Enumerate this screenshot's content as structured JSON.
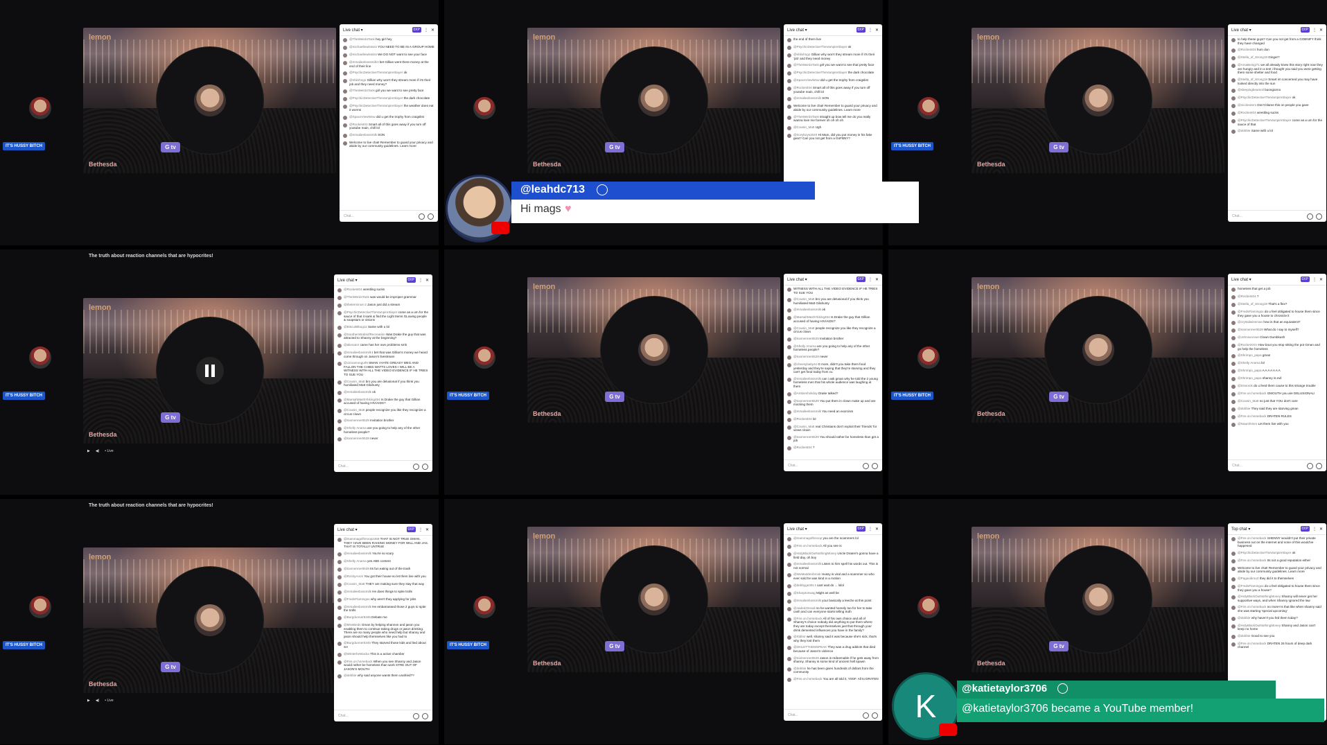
{
  "common": {
    "chat_header": "Live chat",
    "xp_badge": "0XP",
    "brand": "lemon",
    "bethesda": "Bethesda",
    "gtv": "G tv",
    "hussy_label": "IT'S HUSSY BITCH",
    "chat_placeholder": "Chat...",
    "video_title": "The truth about reaction channels that are hypocrites!",
    "live_label": "• Live"
  },
  "tiles": [
    {
      "id": "t1",
      "messages": [
        {
          "author": "@TheWeirdoTank",
          "text": "hey girl hey"
        },
        {
          "author": "@michaellewisssss",
          "text": "YOU NEED TO BE IN A GROUP HOME"
        },
        {
          "author": "@michaellewisssss",
          "text": "We DO NOT want to see your face"
        },
        {
          "author": "@mrsalieebossmilk",
          "text": "I bet Gillian went there money at the end of their line"
        },
        {
          "author": "@PsychicDetectiveTheVampireSlayer",
          "text": "ok"
        },
        {
          "author": "@shilohngo",
          "text": "Gillian why won't they stream more if it's their job and they need money?"
        },
        {
          "author": "@TheWeirdoTank",
          "text": "girl you we want to see pretty face"
        },
        {
          "author": "@PsychicDetectiveTheVampireSlayer",
          "text": "the dark chocolate"
        },
        {
          "author": "@PsychicDetectiveTheVampireSlayer",
          "text": "the weather does eat it worms"
        },
        {
          "author": "@SpaceViewWow",
          "text": "did u get the trophy from craigslist"
        },
        {
          "author": "@Rocket404",
          "text": "Smart all of this goes away if you turn off youtube main, chill lol"
        },
        {
          "author": "@mrsalieebossmilk",
          "text": "SON"
        },
        {
          "author": "",
          "text": "Welcome to live chat! Remember to guard your privacy and abide by our community guidelines. Learn more"
        }
      ]
    },
    {
      "id": "t2",
      "messages": [
        {
          "author": "",
          "text": "the end of them live"
        },
        {
          "author": "@PsychicDetectiveTheVampireSlayer",
          "text": "ok"
        },
        {
          "author": "@shilohngo",
          "text": "Gillian why won't they stream more if it's their 'job' and they need money"
        },
        {
          "author": "@TheWeirdoTank",
          "text": "girl you we want to see that pretty face"
        },
        {
          "author": "@PsychicDetectiveTheVampireSlayer",
          "text": "the dark chocolate"
        },
        {
          "author": "@SpaceViewWow",
          "text": "did u get the trophy from craigslist"
        },
        {
          "author": "@Rocket404",
          "text": "Smart all of this goes away if you turn off youtube main, chill lol"
        },
        {
          "author": "@mrsalieebossmilk",
          "text": "SON"
        },
        {
          "author": "",
          "text": "Welcome to live chat! Remember to guard your privacy and abide by our community guidelines. Learn more"
        },
        {
          "author": "@TheWeirdoTank",
          "text": "straight up bow tell me do you really wanna love me forever oh oh oh oh"
        },
        {
          "author": "@Cousin_Matt",
          "text": "Ugh"
        },
        {
          "author": "@riceyboys2040",
          "text": "Hi Mam, did you put money in his fake gear? Can you not get from a GoFBNY?"
        }
      ]
    },
    {
      "id": "t3",
      "messages": [
        {
          "author": "",
          "text": "to help these guys? Can you not get from a GOBNIFY think they have changed"
        },
        {
          "author": "@Rocket404",
          "text": "hum dun"
        },
        {
          "author": "@Stella_of_strong19",
          "text": "Ginger?"
        },
        {
          "author": "@AmaBeingi71",
          "text": "we all already knew this story right now they are hungry and in a tent i thought you said you were getting them some shelter and food"
        },
        {
          "author": "@Stella_of_strong19",
          "text": "Smart im concerned you may have looked directly into the sun"
        },
        {
          "author": "@sleepingbearsoil",
          "text": "buongiorno"
        },
        {
          "author": "@PsychicDetectiveTheVampireSlayer",
          "text": "ok"
        },
        {
          "author": "@nicoleotero",
          "text": "Don't blame this on people you gave"
        },
        {
          "author": "@Rocket404",
          "text": "wrestling sucks"
        },
        {
          "author": "@PsychicDetectiveTheVampireSlayer",
          "text": "come as a urn for the sauce of that"
        },
        {
          "author": "@debbie",
          "text": "Same with u lol"
        }
      ]
    },
    {
      "id": "t4",
      "paused": true,
      "title": true,
      "controls": true,
      "messages": [
        {
          "author": "@Rocket404",
          "text": "wrestling sucks"
        },
        {
          "author": "@TheWeirdoTank",
          "text": "was would be improper grammar"
        },
        {
          "author": "@theterminus-2",
          "text": "Jason just did a stream"
        },
        {
          "author": "@PsychicDetectiveTheVampireSlayer",
          "text": "come as a urn for the sauce of that it sank & find the Light Items GLowing people & soapstars or visions"
        },
        {
          "author": "@BiscuitBbug11",
          "text": "Same with u lol"
        },
        {
          "author": "@SouthernBabsofRecreation",
          "text": "Was Drake the guy that was attracted to Shanny at the beginning?"
        },
        {
          "author": "@alienator",
          "text": "came has her own problems smh"
        },
        {
          "author": "@mrsalieebossmilk",
          "text": "I bet that was Gillian's money we heard come through on Jason's livestream"
        },
        {
          "author": "@cinnamongurl9",
          "text": "SMAN I HATE GREASY MEG AND FALLON THE CHIBS WATTS LOVES I WILL BE A WITNESS WITH ALL THE VIDEO EVIDENCE IF HE TRIES TO SUE YOU"
        },
        {
          "author": "@Cousin_Matt",
          "text": "bro you are delusional if you think you humiliated Matt Gilahunty"
        },
        {
          "author": "@mrsalieebossmilk",
          "text": "ok"
        },
        {
          "author": "@MarsahMashYkking454",
          "text": "Is Drake the guy that Gillian accused of having HIV/AIDS?"
        },
        {
          "author": "@Cousin_Matt",
          "text": "people recognize you like they recognize a circus clown"
        },
        {
          "author": "@toomenner6529",
          "text": "Invitation brother"
        },
        {
          "author": "@Shelly Anama",
          "text": "are you going to help any of the other homeless people?"
        },
        {
          "author": "@toomenner6529",
          "text": "never"
        }
      ]
    },
    {
      "id": "t5",
      "messages": [
        {
          "author": "",
          "text": "WITNESS WITH ALL THE VIDEO EVIDENCE IF HE TRIES TO SUE YOU"
        },
        {
          "author": "@Cousin_Matt",
          "text": "bro you are delusional if you think you humiliated Matt Gilahunty"
        },
        {
          "author": "@mrsalieebossmilk",
          "text": "ok"
        },
        {
          "author": "@MarsahMashYkking454",
          "text": "Is Drake the guy that Gillian accused of having HIV/AIDS?"
        },
        {
          "author": "@Cousin_Matt",
          "text": "people recognize you like they recognize a circus clown"
        },
        {
          "author": "@toomenner6529",
          "text": "Invitation brother"
        },
        {
          "author": "@Shelly Anama",
          "text": "are you going to help any of the other homeless people?"
        },
        {
          "author": "@toomenner6529",
          "text": "never"
        },
        {
          "author": "@cheesybaby4x",
          "text": "G mom, didn't you take them food yesterday and they're saying that they're starving and they can't get food today from cu"
        },
        {
          "author": "@mrsalieebossmilk",
          "text": "can i ask gman why he told the 2 young homeless men that his whole audience was laughing at them"
        },
        {
          "author": "@Ambienholiday",
          "text": "Drake talked?"
        },
        {
          "author": "@toomenner6529",
          "text": "You put them in clown make up and are mocking them"
        },
        {
          "author": "@mrsalieebossmilk",
          "text": "You need an exorcism"
        },
        {
          "author": "@Rocket404",
          "text": "lol"
        },
        {
          "author": "@Cousin_Matt",
          "text": "real Christians don't exploit their 'friends' for views clown"
        },
        {
          "author": "@toomenner6529",
          "text": "You should rather be homeless than get a job"
        },
        {
          "author": "@Rocket404",
          "text": "?"
        }
      ]
    },
    {
      "id": "t6",
      "messages": [
        {
          "author": "",
          "text": "homeless that get a job"
        },
        {
          "author": "@Rocket404",
          "text": "?"
        },
        {
          "author": "@Stella_of_strong19",
          "text": "That's a flex?"
        },
        {
          "author": "@FredsFlamingox",
          "text": "do u feel obligated to house them since they gave you a house to chronicle it"
        },
        {
          "author": "@crystalwiseman",
          "text": "how is that an equivalent?"
        },
        {
          "author": "@toomenner6529",
          "text": "What do I say to myself?"
        },
        {
          "author": "@JohnsonAwe",
          "text": "Clown Dumbkush"
        },
        {
          "author": "@RocketXXV",
          "text": "How bout you stop sitting the pot Gman and go help the homeless"
        },
        {
          "author": "@Shrimpo_papa",
          "text": "gman"
        },
        {
          "author": "@Shelly Anama",
          "text": "lol"
        },
        {
          "author": "@Shrimpo_papa",
          "text": "A A A A A A A"
        },
        {
          "author": "@Shrimpo_papa",
          "text": "shanny is evil"
        },
        {
          "author": "@trinsonik",
          "text": "do u feed them cause to this strange trouble"
        },
        {
          "author": "@Fire.on.horseback",
          "text": "GMOUTH you are DELUSIONAL!"
        },
        {
          "author": "@Cousin_Matt",
          "text": "no just that YOU don't care"
        },
        {
          "author": "@debbie",
          "text": "They said they are starving gman"
        },
        {
          "author": "@Fire.on.horseback",
          "text": "DRATEN RULES"
        },
        {
          "author": "@Naamhrism",
          "text": "Let them live with you"
        }
      ]
    },
    {
      "id": "t7",
      "title": true,
      "controls": true,
      "messages": [
        {
          "author": "@mammagolfsnoop2469",
          "text": "THAT IS NOT TRUE GMAN. THEY HAVE BEEN RAISING MONEY FOR WILL AND JAS. THAT IS TOTALLY UNTRUE"
        },
        {
          "author": "@mrsalieebossmilk",
          "text": "You're so scary"
        },
        {
          "author": "@Shelly Anama",
          "text": "yes ABE content"
        },
        {
          "author": "@toomenner6529",
          "text": "Its fun eating out of the trash"
        },
        {
          "author": "@RockyAnon",
          "text": "You got their house so let them live with you"
        },
        {
          "author": "@Cousin_Matt",
          "text": "THEY are making sure they stay that way"
        },
        {
          "author": "@mrsalieebossmilk",
          "text": "He does things to spite trolls"
        },
        {
          "author": "@FredsFlamingox",
          "text": "why aren't they applying for jobs"
        },
        {
          "author": "@mrsalieebossmilk",
          "text": "He embarrassed those 2 guys to spite the trolls"
        },
        {
          "author": "@Burgdunner5345",
          "text": "Debate me"
        },
        {
          "author": "@MissBeds",
          "text": "Gman by helping shannon and jason you enabling them to continue taking drugs or jason drinking. There are so many people who need help but shanny and jason should help themselves like you had to"
        },
        {
          "author": "@Burgdunner5345",
          "text": "They starved those kids and lied about SA"
        },
        {
          "author": "@WinterheWacka",
          "text": "This is a active chamber"
        },
        {
          "author": "@Fire.on.horseback",
          "text": "When you see Shanny and Jason would rather be homeless than work STRE OUT OF JASON'S MOUTH"
        },
        {
          "author": "@debbie",
          "text": "why said anyone wants them unafried??"
        }
      ]
    },
    {
      "id": "t8",
      "messages": [
        {
          "author": "@mammagolfsnoop",
          "text": "you are the scammers lol"
        },
        {
          "author": "@Fire.on.horseback",
          "text": "All you see is"
        },
        {
          "author": "@HolyBlackOutNothingMoney",
          "text": "Uncle Draten's gonna have a field day, oh boy"
        },
        {
          "author": "@mrsalieebossmilk",
          "text": "Listen to him spell his words out. This is not normal"
        },
        {
          "author": "@WoMaddenbrook",
          "text": "Hussy is viral and a scammer so who ever sold he was kind in a motion"
        },
        {
          "author": "@debbyge391",
          "text": "I cant wait do ... lolol"
        },
        {
          "author": "@Sharptonwag",
          "text": "Might as well be"
        },
        {
          "author": "@mrsalieebossmilk",
          "text": "your basically a leeche at this point"
        },
        {
          "author": "@JadedJSnaid",
          "text": "no he wanted homely too for her to take cash and can everyone starts telling truth"
        },
        {
          "author": "@Fire.on.horseback",
          "text": "All of his own choice and all of Shanny's choice nobody did anything to put them where they are today except themselves just that through your drink demented influences you have in the family?"
        },
        {
          "author": "@rbbbsr",
          "text": "well, shanny said it was because she's sick, that's why they lost them"
        },
        {
          "author": "@OHLETTHEMSPEAK",
          "text": "They was a drug addicts that died because of Jason's violence"
        },
        {
          "author": "@toomenner6529",
          "text": "Jason is redeemable if he gets away from shanny. Shanny is some kind of ancient hell spawn"
        },
        {
          "author": "@debbie",
          "text": "he has been given hundreds of dollars from the community"
        },
        {
          "author": "@Fire.on.horseback",
          "text": "You are all told it, Y0OF. All to DRATEN"
        }
      ]
    },
    {
      "id": "t9",
      "chat_header": "Top chat",
      "messages": [
        {
          "author": "@Fire.on.horseback",
          "text": "SHENNY wouldn't put their private business out on the internet and none of this would've happened"
        },
        {
          "author": "@PsychicDetectiveTheVampireSlayer",
          "text": "ok"
        },
        {
          "author": "@Fire.on.horseback",
          "text": "Its not a good reputation either"
        },
        {
          "author": "",
          "text": "Welcome to live chat! Remember to guard your privacy and abide by our community guidelines. Learn more"
        },
        {
          "author": "@Pagaxibrou3",
          "text": "they did it to themselves"
        },
        {
          "author": "@FredsFlamingox",
          "text": "do u feel obligated to house them since they gave you a house?"
        },
        {
          "author": "@HolyBlackOutNothingMoney",
          "text": "Shanny will never get her supportive ways, and when Shanny ignored the law"
        },
        {
          "author": "@Fire.on.horseback",
          "text": "no more! Is that like when shanny said she was starting 'special upcoming'"
        },
        {
          "author": "@debbie",
          "text": "why haven't you fed them today?"
        },
        {
          "author": "@HolyBlackOutNothingMoney",
          "text": "Shanny and Jason can't keep no home"
        },
        {
          "author": "@debbie",
          "text": "Good to see you"
        },
        {
          "author": "@Fire.on.horseback",
          "text": "DRATEN 26 hours of deep dark channel"
        }
      ]
    }
  ],
  "overlays": {
    "leah": {
      "handle": "@leahdc713",
      "message": "Hi mags"
    },
    "katie": {
      "handle": "@katietaylor3706",
      "message": "@katietaylor3706 became a YouTube member!",
      "initial": "K"
    }
  }
}
